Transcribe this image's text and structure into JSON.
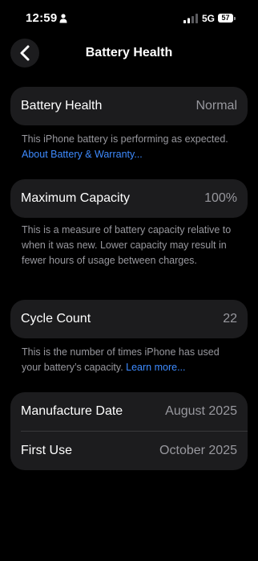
{
  "status_bar": {
    "time": "12:59",
    "network": "5G",
    "battery_level": "57"
  },
  "nav": {
    "title": "Battery Health"
  },
  "health": {
    "label": "Battery Health",
    "value": "Normal",
    "note": "This iPhone battery is performing as expected. ",
    "link": "About Battery & Warranty..."
  },
  "capacity": {
    "label": "Maximum Capacity",
    "value": "100%",
    "note": "This is a measure of battery capacity relative to when it was new. Lower capacity may result in fewer hours of usage between charges."
  },
  "cycles": {
    "label": "Cycle Count",
    "value": "22",
    "note": "This is the number of times iPhone has used your battery’s capacity. ",
    "link": "Learn more..."
  },
  "dates": {
    "manufacture_label": "Manufacture Date",
    "manufacture_value": "August 2025",
    "first_use_label": "First Use",
    "first_use_value": "October 2025"
  },
  "colors": {
    "background": "#000000",
    "card": "#1c1c1e",
    "secondary_text": "#98989e",
    "link": "#3e8bff"
  }
}
